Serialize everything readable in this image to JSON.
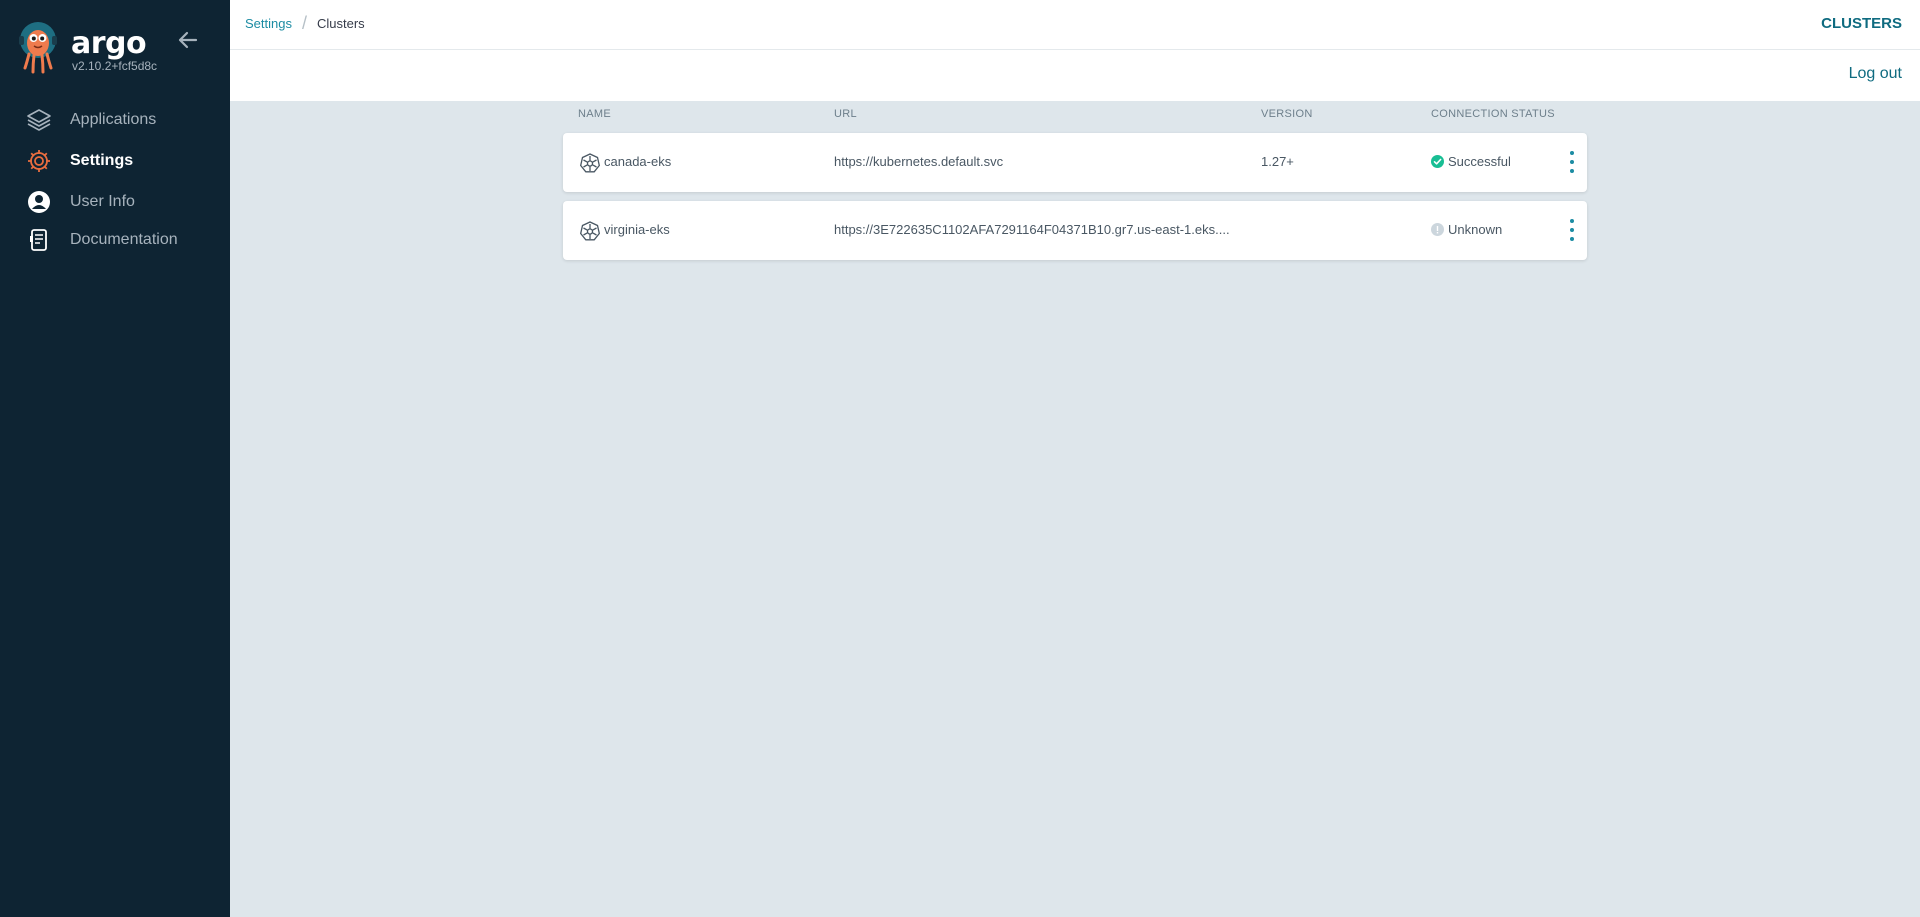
{
  "app": {
    "name": "argo",
    "version": "v2.10.2+fcf5d8c"
  },
  "sidebar": {
    "items": [
      {
        "label": "Applications",
        "icon": "layers-icon",
        "active": false
      },
      {
        "label": "Settings",
        "icon": "gear-icon",
        "active": true
      },
      {
        "label": "User Info",
        "icon": "user-circle-icon",
        "active": false
      },
      {
        "label": "Documentation",
        "icon": "book-icon",
        "active": false
      }
    ]
  },
  "header": {
    "breadcrumb": {
      "parent": "Settings",
      "separator": "/",
      "current": "Clusters"
    },
    "title": "CLUSTERS",
    "logout_label": "Log out"
  },
  "table": {
    "columns": {
      "name": "NAME",
      "url": "URL",
      "version": "VERSION",
      "status": "CONNECTION STATUS"
    },
    "rows": [
      {
        "name": "canada-eks",
        "url": "https://kubernetes.default.svc",
        "version": "1.27+",
        "status": "Successful",
        "status_color": "#18be94"
      },
      {
        "name": "virginia-eks",
        "url": "https://3E722635C1102AFA7291164F04371B10.gr7.us-east-1.eks....",
        "version": "",
        "status": "Unknown",
        "status_color": "#ccd6dd"
      }
    ]
  },
  "colors": {
    "sidebar_bg": "#0e2433",
    "accent": "#1c8ca3",
    "title": "#0f6b80",
    "content_bg": "#dee6eb",
    "settings_icon": "#e96d3f"
  }
}
